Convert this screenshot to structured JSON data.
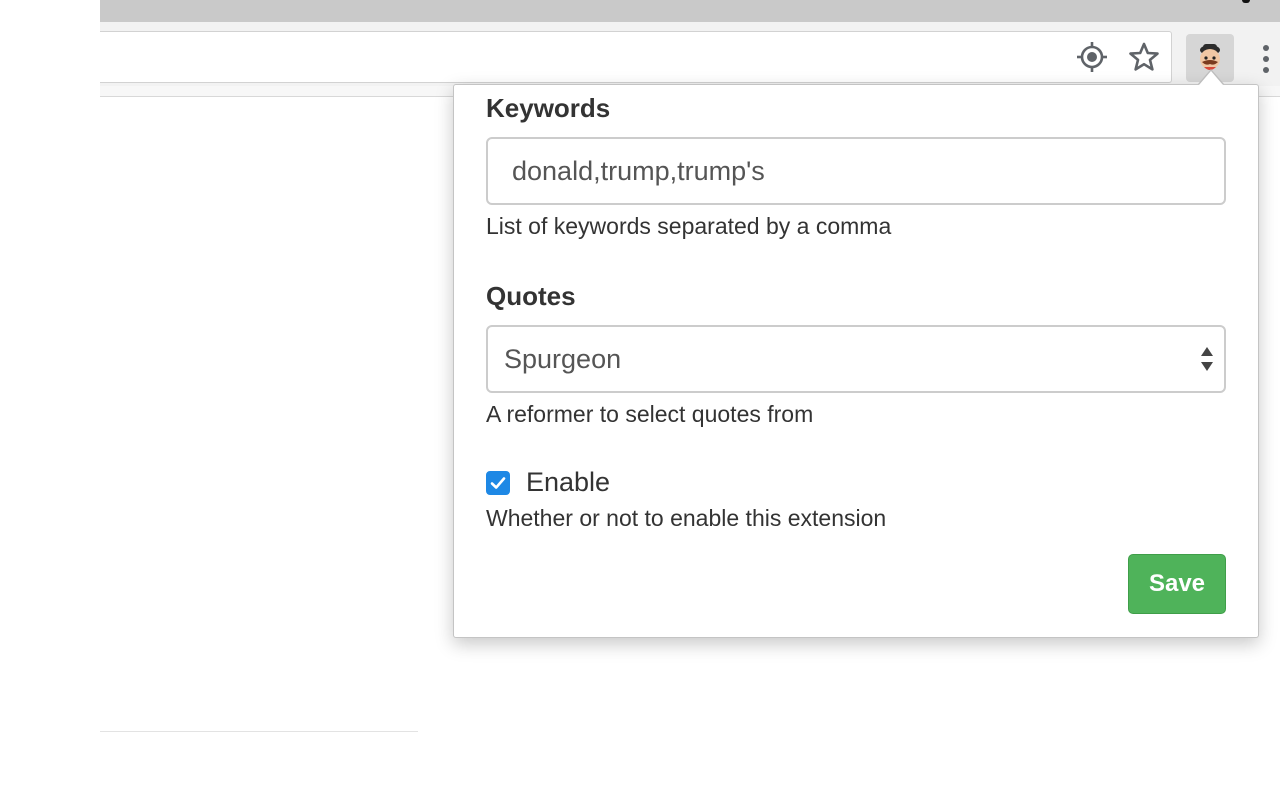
{
  "browser": {
    "toolbar_icons": [
      "location-target-icon",
      "bookmark-star-icon",
      "extension-avatar-icon",
      "more-menu-icon"
    ]
  },
  "popup": {
    "keywords": {
      "label": "Keywords",
      "value": "donald,trump,trump's",
      "help": "List of keywords separated by a comma"
    },
    "quotes": {
      "label": "Quotes",
      "selected": "Spurgeon",
      "help": "A reformer to select quotes from"
    },
    "enable": {
      "label": "Enable",
      "checked": true,
      "help": "Whether or not to enable this extension"
    },
    "save_label": "Save"
  },
  "colors": {
    "save_button": "#4fb35a",
    "checkbox_accent": "#1e88e5",
    "text": "#333333"
  }
}
